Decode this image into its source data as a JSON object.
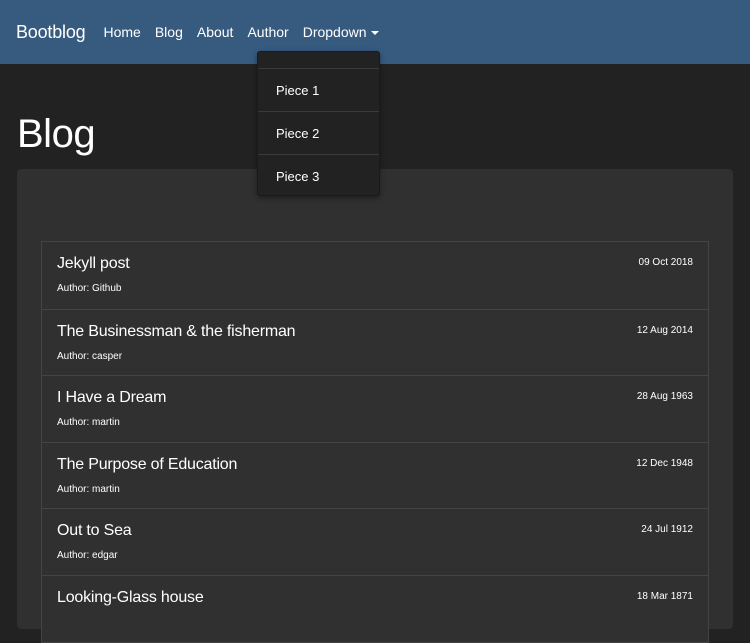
{
  "navbar": {
    "brand": "Bootblog",
    "links": [
      "Home",
      "Blog",
      "About",
      "Author"
    ],
    "dropdown_label": "Dropdown"
  },
  "dropdown": {
    "items": [
      "Piece 1",
      "Piece 2",
      "Piece 3"
    ]
  },
  "page": {
    "title": "Blog"
  },
  "posts": [
    {
      "title": "Jekyll post",
      "author": "Author: Github",
      "date": "09 Oct 2018"
    },
    {
      "title": "The Businessman & the fisherman",
      "author": "Author: casper",
      "date": "12 Aug 2014"
    },
    {
      "title": "I Have a Dream",
      "author": "Author: martin",
      "date": "28 Aug 1963"
    },
    {
      "title": "The Purpose of Education",
      "author": "Author: martin",
      "date": "12 Dec 1948"
    },
    {
      "title": "Out to Sea",
      "author": "Author: edgar",
      "date": "24 Jul 1912"
    },
    {
      "title": "Looking-Glass house",
      "author": "",
      "date": "18 Mar 1871"
    }
  ],
  "colors": {
    "navbar_bg": "#375a7f",
    "page_bg": "#222222",
    "card_bg": "#303030",
    "text": "#ffffff"
  }
}
